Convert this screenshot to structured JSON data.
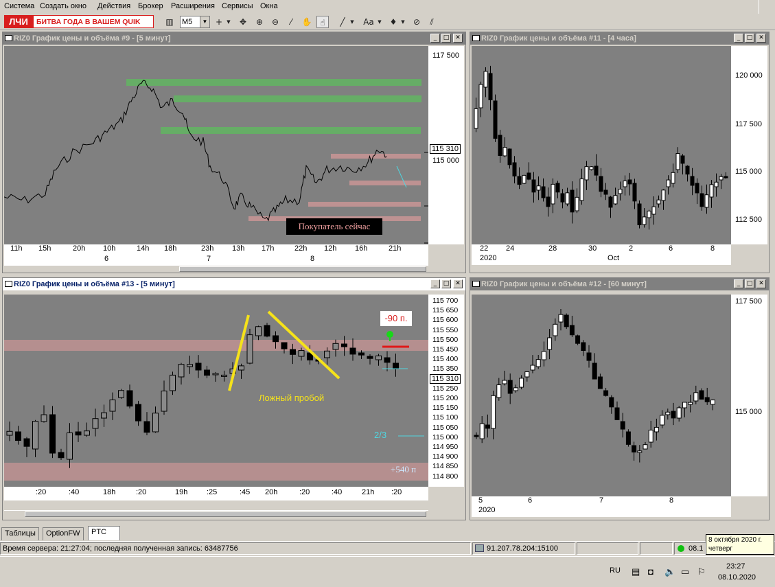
{
  "menu": [
    "Система",
    "Создать окно",
    "Действия",
    "Брокер",
    "Расширения",
    "Сервисы",
    "Окна"
  ],
  "toolbar": {
    "logo": "ЛЧИ",
    "brand": "БИТВА ГОДА В ВАШЕМ QUIK",
    "interval": "M5",
    "text_tool": "Aa"
  },
  "windows": {
    "w9": {
      "title": "RIZ0 График цены и объёма #9 - [5 минут]",
      "y_ticks": [
        "117 500",
        "115 000"
      ],
      "price_label": "115 310",
      "annotation": "Покупатель сейчас",
      "x_ticks": [
        "11h",
        "15h",
        "20h",
        "10h",
        "14h",
        "18h",
        "23h",
        "13h",
        "17h",
        "22h",
        "12h",
        "16h",
        "21h"
      ],
      "x_dates": [
        "6",
        "7",
        "8"
      ]
    },
    "w11": {
      "title": "RIZ0 График цены и объёма #11 - [4 часа]",
      "y_ticks": [
        "120 000",
        "117 500",
        "115 000",
        "112 500"
      ],
      "x_ticks": [
        "22",
        "24",
        "28",
        "30",
        "2",
        "6",
        "8"
      ],
      "x_sub": [
        "2020",
        "Oct"
      ]
    },
    "w13": {
      "title": "RIZ0 График цены и объёма #13 - [5 минут]",
      "y_ticks": [
        "115 700",
        "115 650",
        "115 600",
        "115 550",
        "115 500",
        "115 450",
        "115 400",
        "115 350",
        "115 300",
        "115 250",
        "115 200",
        "115 150",
        "115 100",
        "115 050",
        "115 000",
        "114 950",
        "114 900",
        "114 850",
        "114 800"
      ],
      "price_label": "115 310",
      "label_loss": "-90 п.",
      "label_false": "Ложный пробой",
      "label_frac": "2/3",
      "label_gain": "+540 п",
      "x_ticks": [
        ":20",
        ":40",
        "18h",
        ":20",
        "19h",
        ":25",
        ":45",
        "20h",
        ":20",
        ":40",
        "21h",
        ":20"
      ]
    },
    "w12": {
      "title": "RIZ0 График цены и объёма #12 - [60 минут]",
      "y_ticks": [
        "117 500",
        "115 000"
      ],
      "x_ticks": [
        "5",
        "6",
        "7",
        "8"
      ],
      "x_sub": [
        "2020"
      ]
    }
  },
  "tabs": [
    "Таблицы",
    "OptionFW",
    "PTC"
  ],
  "status": {
    "server_time": "Время сервера: 21:27:04; последняя полученная запись: 63487756",
    "connection": "91.207.78.204:15100",
    "partial": "08.1"
  },
  "tooltip": {
    "date": "8 октября 2020 г.",
    "weekday": "четверг"
  },
  "taskbar": {
    "lang": "RU",
    "time": "23:27",
    "date": "08.10.2020"
  },
  "colors": {
    "plot_bg": "#808080",
    "zone_green": "#5fb85f",
    "zone_red": "#d99a9a",
    "annotation_yellow": "#f5e21a",
    "logo_red": "#d81e1e"
  }
}
